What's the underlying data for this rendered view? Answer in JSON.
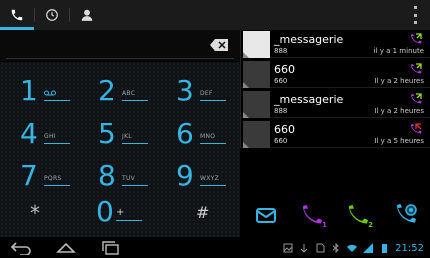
{
  "tabs": [
    {
      "id": "phone",
      "icon": "phone-icon",
      "active": true
    },
    {
      "id": "recent",
      "icon": "clock-icon",
      "active": false
    },
    {
      "id": "contacts",
      "icon": "person-icon",
      "active": false
    }
  ],
  "dialpad": {
    "keys": [
      {
        "digit": "1",
        "letters": ""
      },
      {
        "digit": "2",
        "letters": "ABC"
      },
      {
        "digit": "3",
        "letters": "DEF"
      },
      {
        "digit": "4",
        "letters": "GHI"
      },
      {
        "digit": "5",
        "letters": "JKL"
      },
      {
        "digit": "6",
        "letters": "MNO"
      },
      {
        "digit": "7",
        "letters": "PQRS"
      },
      {
        "digit": "8",
        "letters": "TUV"
      },
      {
        "digit": "9",
        "letters": "WXYZ"
      }
    ],
    "star": "*",
    "zero": "0",
    "plus": "+",
    "hash": "#"
  },
  "call_log": [
    {
      "name": "_messagerie",
      "number": "888",
      "time": "il y a 1 minute",
      "type": "outgoing"
    },
    {
      "name": "660",
      "number": "660",
      "time": "Il y a 2 heures",
      "type": "outgoing"
    },
    {
      "name": "_messagerie",
      "number": "888",
      "time": "Il y a 2 heures",
      "type": "outgoing"
    },
    {
      "name": "660",
      "number": "660",
      "time": "Il y a 5 heures",
      "type": "missed"
    }
  ],
  "actions": [
    {
      "icon": "envelope-icon",
      "badge": ""
    },
    {
      "icon": "call-sim-1-icon",
      "badge": "1"
    },
    {
      "icon": "call-sim-2-icon",
      "badge": "2"
    },
    {
      "icon": "video-call-icon",
      "badge": ""
    }
  ],
  "status_bar": {
    "time": "21:52"
  },
  "colors": {
    "accent": "#33b5e5",
    "sim1": "#b233e5",
    "sim2": "#66cc00"
  }
}
